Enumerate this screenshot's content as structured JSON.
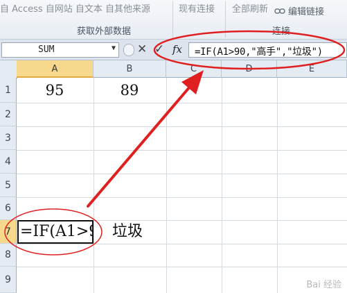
{
  "ribbon": {
    "top_text_1": "自 Access  自网站  自文本  自其他来源",
    "top_text_2": "现有连接",
    "top_text_3": "全部刷新",
    "edit_links_label": "编辑链接",
    "group_external_data": "获取外部数据",
    "group_connections": "连接"
  },
  "formula_bar": {
    "name_box": "SUM",
    "cancel_symbol": "✕",
    "enter_symbol": "✓",
    "fx_label": "fx",
    "formula": "=IF(A1>90,\"高手\",\"垃圾\")"
  },
  "grid": {
    "columns": [
      "A",
      "B",
      "C",
      "D",
      "E"
    ],
    "rows": [
      "1",
      "2",
      "3",
      "4",
      "5",
      "6",
      "7",
      "8",
      "9"
    ],
    "cells": {
      "A1": "95",
      "B1": "89",
      "A7": "=IF(A1>9",
      "B7": "垃圾"
    },
    "selected_column": "A",
    "selected_row": "7"
  },
  "annotation": {
    "highlight_color": "#e02020"
  },
  "watermark": "Bai 经验"
}
